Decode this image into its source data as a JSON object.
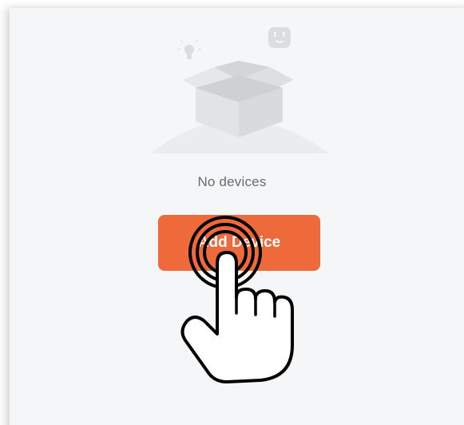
{
  "empty_state": {
    "message": "No devices",
    "add_button_label": "Add Device"
  },
  "icons": {
    "bulb": "bulb-icon",
    "plug": "plug-icon",
    "box": "open-box-icon",
    "hand": "tap-hand-icon"
  },
  "colors": {
    "accent": "#ee6a3a",
    "background": "#f5f6f8",
    "muted_text": "#6b6b6b",
    "illustration_gray": "#e4e5e7"
  }
}
